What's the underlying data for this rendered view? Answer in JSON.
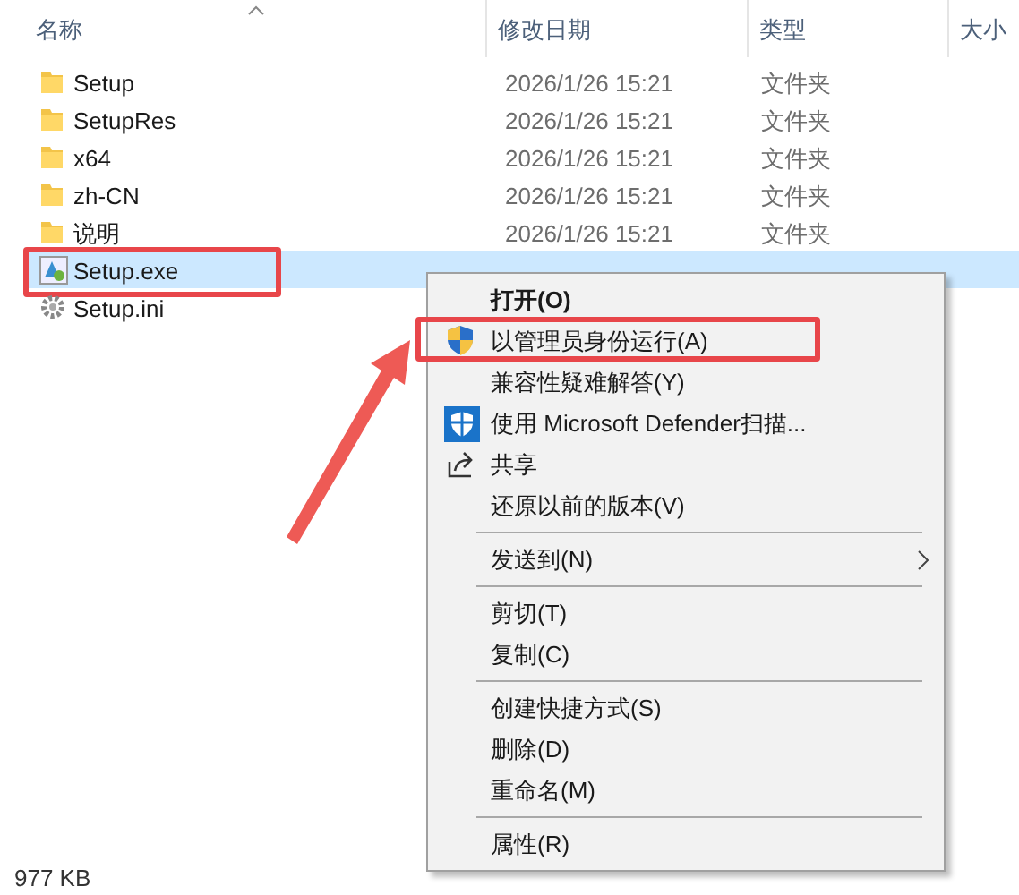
{
  "columns": [
    {
      "label": "名称",
      "sorted": true
    },
    {
      "label": "修改日期",
      "sorted": false
    },
    {
      "label": "类型",
      "sorted": false
    },
    {
      "label": "大小",
      "sorted": false
    }
  ],
  "files": [
    {
      "name": "Setup",
      "date": "2026/1/26 15:21",
      "type": "文件夹",
      "kind": "folder",
      "selected": false,
      "annotated": false
    },
    {
      "name": "SetupRes",
      "date": "2026/1/26 15:21",
      "type": "文件夹",
      "kind": "folder",
      "selected": false,
      "annotated": false
    },
    {
      "name": "x64",
      "date": "2026/1/26 15:21",
      "type": "文件夹",
      "kind": "folder",
      "selected": false,
      "annotated": false
    },
    {
      "name": "zh-CN",
      "date": "2026/1/26 15:21",
      "type": "文件夹",
      "kind": "folder",
      "selected": false,
      "annotated": false
    },
    {
      "name": "说明",
      "date": "2026/1/26 15:21",
      "type": "文件夹",
      "kind": "folder",
      "selected": false,
      "annotated": false
    },
    {
      "name": "Setup.exe",
      "kind": "exe",
      "selected": true,
      "annotated": true
    },
    {
      "name": "Setup.ini",
      "kind": "ini",
      "selected": false,
      "annotated": false
    }
  ],
  "context_menu": [
    {
      "kind": "item",
      "label": "打开(O)",
      "bold": true,
      "annotated": false
    },
    {
      "kind": "admin",
      "label": "以管理员身份运行(A)",
      "bold": false,
      "annotated": true
    },
    {
      "kind": "item",
      "label": "兼容性疑难解答(Y)",
      "bold": false,
      "annotated": false
    },
    {
      "kind": "scan",
      "label": "使用 Microsoft Defender扫描...",
      "bold": false,
      "annotated": false
    },
    {
      "kind": "share",
      "label": "共享",
      "bold": false,
      "annotated": false
    },
    {
      "kind": "item",
      "label": "还原以前的版本(V)",
      "bold": false,
      "annotated": false
    },
    {
      "kind": "separator"
    },
    {
      "kind": "submenu",
      "label": "发送到(N)",
      "bold": false,
      "annotated": false
    },
    {
      "kind": "separator"
    },
    {
      "kind": "item",
      "label": "剪切(T)",
      "bold": false,
      "annotated": false
    },
    {
      "kind": "item",
      "label": "复制(C)",
      "bold": false,
      "annotated": false
    },
    {
      "kind": "separator"
    },
    {
      "kind": "item",
      "label": "创建快捷方式(S)",
      "bold": false,
      "annotated": false
    },
    {
      "kind": "item",
      "label": "删除(D)",
      "bold": false,
      "annotated": false
    },
    {
      "kind": "item",
      "label": "重命名(M)",
      "bold": false,
      "annotated": false
    },
    {
      "kind": "separator"
    },
    {
      "kind": "item",
      "label": "属性(R)",
      "bold": false,
      "annotated": false
    }
  ],
  "status_bar": {
    "size": "977 KB"
  }
}
